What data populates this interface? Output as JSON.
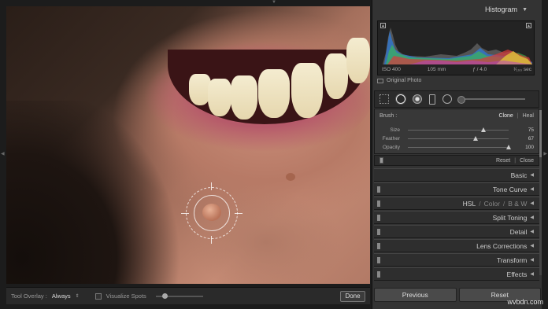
{
  "histogram": {
    "title": "Histogram",
    "iso": "ISO 400",
    "focal": "105 mm",
    "aperture": "ƒ / 4.0",
    "shutter": "¹⁄₁₀₀ sec",
    "original_photo": "Original Photo"
  },
  "brush": {
    "label": "Brush :",
    "clone": "Clone",
    "heal": "Heal",
    "sliders": [
      {
        "label": "Size",
        "value": "75",
        "fraction": 0.75
      },
      {
        "label": "Feather",
        "value": "67",
        "fraction": 0.67
      },
      {
        "label": "Opacity",
        "value": "100",
        "fraction": 1.0
      }
    ],
    "reset": "Reset",
    "close": "Close"
  },
  "sections": [
    {
      "label": "Basic"
    },
    {
      "label": "Tone Curve"
    },
    {
      "label": "HSL",
      "extra1": "Color",
      "extra2": "B & W"
    },
    {
      "label": "Split Toning"
    },
    {
      "label": "Detail"
    },
    {
      "label": "Lens Corrections"
    },
    {
      "label": "Transform"
    },
    {
      "label": "Effects"
    }
  ],
  "buttons": {
    "previous": "Previous",
    "reset": "Reset"
  },
  "toolbar": {
    "overlay_label": "Tool Overlay :",
    "overlay_value": "Always",
    "visualize": "Visualize Spots",
    "done": "Done"
  },
  "watermark": "wvbdn.com",
  "icons": {
    "arrow": "triangle-left-icon",
    "collapse": "triangle-down-icon"
  }
}
